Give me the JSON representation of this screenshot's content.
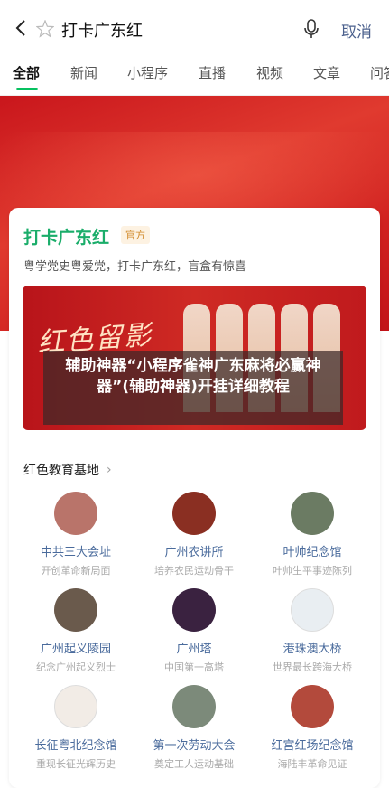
{
  "search": {
    "query": "打卡广东红",
    "cancel_label": "取消"
  },
  "tabs": [
    {
      "label": "全部"
    },
    {
      "label": "新闻"
    },
    {
      "label": "小程序"
    },
    {
      "label": "直播"
    },
    {
      "label": "视频"
    },
    {
      "label": "文章"
    },
    {
      "label": "问答"
    }
  ],
  "card": {
    "title": "打卡广东红",
    "badge": "官方",
    "description": "粤学党史粤爱党，打卡广东红，盲盒有惊喜",
    "banner_title": "红色留影",
    "overlay_text": "辅助神器“小程序雀神广东麻将必赢神器”(辅助神器)开挂详细教程"
  },
  "section": {
    "title": "红色教育基地",
    "chevron": "›"
  },
  "bases": [
    {
      "name": "中共三大会址",
      "subtitle": "开创革命新局面",
      "color": "#b9746a"
    },
    {
      "name": "广州农讲所",
      "subtitle": "培养农民运动骨干",
      "color": "#8a2f22"
    },
    {
      "name": "叶帅纪念馆",
      "subtitle": "叶帅生平事迹陈列",
      "color": "#6b7b63"
    },
    {
      "name": "广州起义陵园",
      "subtitle": "纪念广州起义烈士",
      "color": "#6a5a4c"
    },
    {
      "name": "广州塔",
      "subtitle": "中国第一高塔",
      "color": "#3a2240"
    },
    {
      "name": "港珠澳大桥",
      "subtitle": "世界最长跨海大桥",
      "color": "#e9eef2"
    },
    {
      "name": "长征粤北纪念馆",
      "subtitle": "重现长征光辉历史",
      "color": "#f2ece6"
    },
    {
      "name": "第一次劳动大会",
      "subtitle": "奠定工人运动基础",
      "color": "#7c8a7a"
    },
    {
      "name": "红宫红场纪念馆",
      "subtitle": "海陆丰革命见证",
      "color": "#b34a3c"
    }
  ]
}
